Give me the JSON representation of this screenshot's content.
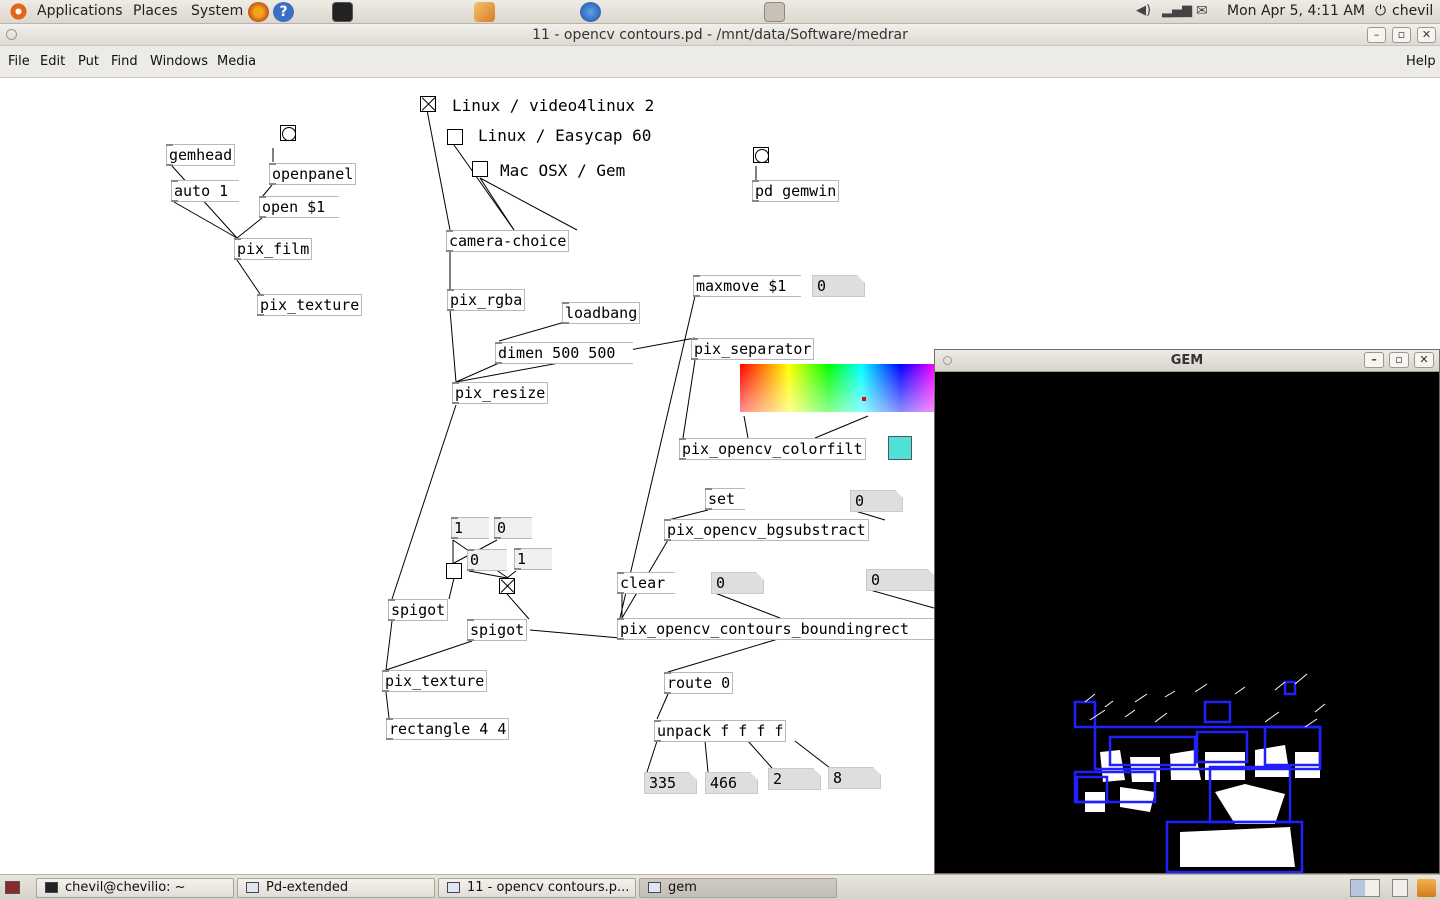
{
  "top_panel": {
    "menus": [
      "Applications",
      "Places",
      "System"
    ],
    "clock": "Mon Apr  5,  4:11 AM",
    "user": "chevil"
  },
  "window": {
    "title": "11 - opencv contours.pd  - /mnt/data/Software/medrar"
  },
  "menubar": {
    "items": [
      "File",
      "Edit",
      "Put",
      "Find",
      "Windows",
      "Media"
    ],
    "help": "Help"
  },
  "patch": {
    "comments": {
      "v4l2": "Linux / video4linux 2",
      "easycap": "Linux / Easycap 60",
      "macosx": "Mac OSX / Gem"
    },
    "objects": {
      "gemhead": "gemhead",
      "auto": "auto 1",
      "openpanel": "openpanel",
      "open": "open $1",
      "pix_film": "pix_film",
      "pix_texture_top": "pix_texture",
      "camera_choice": "camera-choice",
      "pix_rgba": "pix_rgba",
      "loadbang": "loadbang",
      "dimen": "dimen 500 500",
      "pix_resize": "pix_resize",
      "pd_gemwin": "pd gemwin",
      "maxmove": "maxmove $1",
      "pix_separator": "pix_separator",
      "colorfilt": "pix_opencv_colorfilt",
      "set": "set",
      "bgsubstract": "pix_opencv_bgsubstract",
      "clear": "clear",
      "contours": "pix_opencv_contours_boundingrect",
      "spigot_left": "spigot",
      "spigot_mid": "spigot",
      "pix_texture_bottom": "pix_texture",
      "rectangle": "rectangle 4 4",
      "route": "route 0",
      "unpack": "unpack f f f f",
      "msg_1a": "1",
      "msg_0a": "0",
      "msg_0b": "0",
      "msg_1b": "1"
    },
    "numbers": {
      "maxmove_num": "0",
      "bg_num": "0",
      "contour_num_a": "0",
      "contour_num_b": "0",
      "out1": "335",
      "out2": "466",
      "out3": "2",
      "out4": "8"
    },
    "colors": {
      "swatch": "#4fe0d8"
    }
  },
  "gem_window": {
    "title": "GEM"
  },
  "taskbar": {
    "tasks": [
      "chevil@chevilio: ~",
      "Pd-extended",
      "11 - opencv contours.p...",
      "gem"
    ]
  }
}
